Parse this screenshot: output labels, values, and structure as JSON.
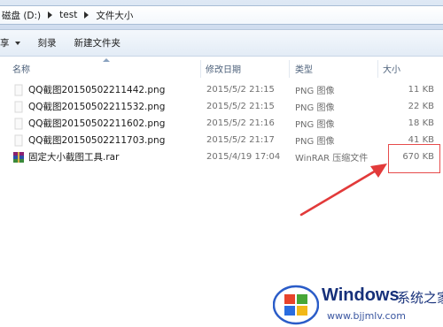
{
  "address": {
    "crumbs": [
      "磁盘 (D:)",
      "test",
      "文件大小"
    ]
  },
  "toolbar": {
    "share_label": "享",
    "burn_label": "刻录",
    "new_folder_label": "新建文件夹"
  },
  "columns": {
    "name": "名称",
    "date": "修改日期",
    "type": "类型",
    "size": "大小"
  },
  "files": [
    {
      "name": "QQ截图20150502211442.png",
      "date": "2015/5/2 21:15",
      "type": "PNG 图像",
      "size": "11 KB",
      "icon": "png-file-icon"
    },
    {
      "name": "QQ截图20150502211532.png",
      "date": "2015/5/2 21:15",
      "type": "PNG 图像",
      "size": "22 KB",
      "icon": "png-file-icon"
    },
    {
      "name": "QQ截图20150502211602.png",
      "date": "2015/5/2 21:16",
      "type": "PNG 图像",
      "size": "18 KB",
      "icon": "png-file-icon"
    },
    {
      "name": "QQ截图20150502211703.png",
      "date": "2015/5/2 21:17",
      "type": "PNG 图像",
      "size": "41 KB",
      "icon": "png-file-icon"
    },
    {
      "name": "固定大小截图工具.rar",
      "date": "2015/4/19 17:04",
      "type": "WinRAR 压缩文件",
      "size": "670 KB",
      "icon": "winrar-archive-icon"
    }
  ],
  "watermark": {
    "brand": "Windows",
    "suffix": "系统之家",
    "url": "www.bjjmlv.com"
  },
  "colors": {
    "highlight": "#e64b4b",
    "arrow": "#e23a3a",
    "watermark": "#16307a"
  }
}
